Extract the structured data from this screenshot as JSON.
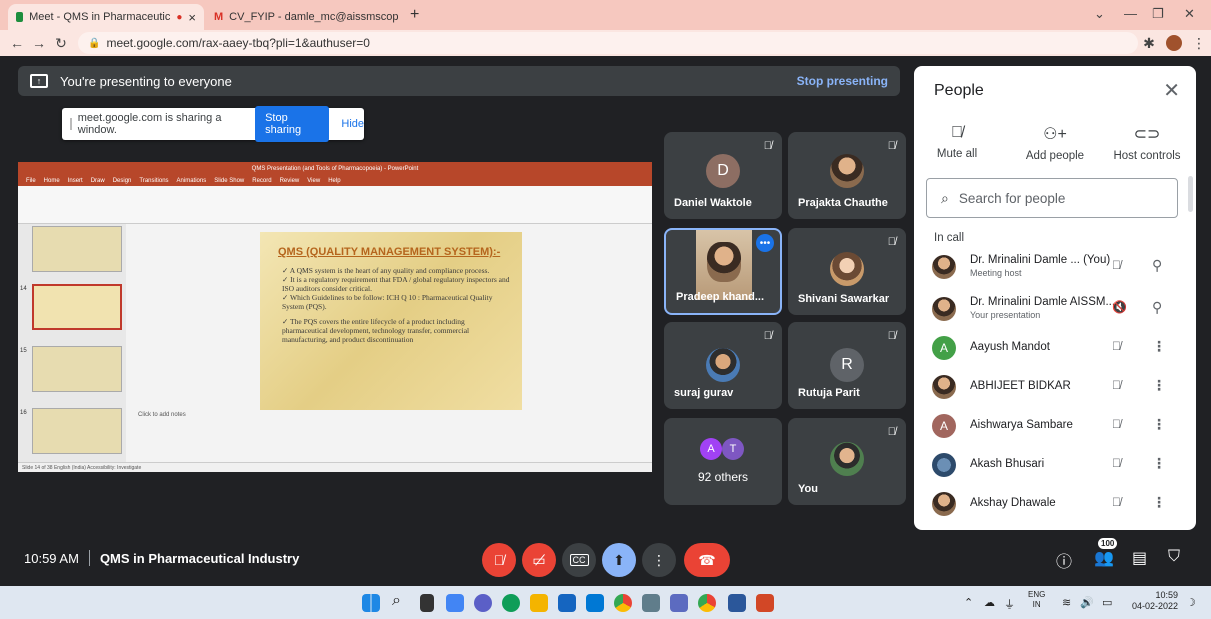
{
  "browser": {
    "tabs": [
      {
        "title": "Meet - QMS in Pharmaceutic",
        "active": true
      },
      {
        "title": "CV_FYIP - damle_mc@aissmscop",
        "active": false
      }
    ],
    "new_tab": "+",
    "url": "meet.google.com/rax-aaey-tbq?pli=1&authuser=0"
  },
  "presenting": {
    "message": "You're presenting to everyone",
    "stop_label": "Stop presenting"
  },
  "share_banner": {
    "text": "meet.google.com is sharing a window.",
    "stop_label": "Stop sharing",
    "hide_label": "Hide"
  },
  "ppt": {
    "window_title": "QMS Presentation (and Tools of Pharmacopoeia) - PowerPoint",
    "menu": [
      "File",
      "Home",
      "Insert",
      "Draw",
      "Design",
      "Transitions",
      "Animations",
      "Slide Show",
      "Record",
      "Review",
      "View",
      "Help"
    ],
    "slide_numbers": [
      "14",
      "15",
      "16"
    ],
    "slide_title": "QMS (QUALITY MANAGEMENT SYSTEM):-",
    "bullets": [
      "A QMS system is the heart of any quality and compliance process.",
      "It is a regulatory requirement that FDA / global regulatory inspectors and ISO auditors consider critical.",
      "Which Guidelines to be follow: ICH Q 10 : Pharmaceutical Quality System (PQS).",
      "The PQS covers the entire lifecycle of a product including pharmaceutical development, technology transfer, commercial manufacturing, and product discontinuation"
    ],
    "notes_placeholder": "Click to add notes",
    "status": "Slide 14 of 38   English (India)   Accessibility: Investigate"
  },
  "tiles": [
    {
      "name": "Daniel Waktole",
      "letter": "D",
      "color": "#8d6e63"
    },
    {
      "name": "Prajakta Chauthe"
    },
    {
      "name": "Pradeep khand..."
    },
    {
      "name": "Shivani Sawarkar"
    },
    {
      "name": "suraj gurav"
    },
    {
      "name": "Rutuja Parit",
      "letter": "R",
      "color": "#5f6368"
    },
    {
      "name": "92 others",
      "letters": [
        "A",
        "T"
      ]
    },
    {
      "name": "You"
    }
  ],
  "people": {
    "title": "People",
    "actions": [
      {
        "label": "Mute all",
        "icon": "mic-off-icon"
      },
      {
        "label": "Add people",
        "icon": "add-person-icon"
      },
      {
        "label": "Host controls",
        "icon": "toggle-icon"
      }
    ],
    "search_placeholder": "Search for people",
    "section": "In call",
    "list": [
      {
        "name": "Dr. Mrinalini Damle ...  (You)",
        "sub": "Meeting host"
      },
      {
        "name": "Dr. Mrinalini Damle AISSM...",
        "sub": "Your presentation"
      },
      {
        "name": "Aayush Mandot",
        "letter": "A",
        "color": "#43a047"
      },
      {
        "name": "ABHIJEET BIDKAR"
      },
      {
        "name": "Aishwarya Sambare",
        "letter": "A",
        "color": "#a1665e"
      },
      {
        "name": "Akash Bhusari"
      },
      {
        "name": "Akshay Dhawale"
      }
    ]
  },
  "meeting": {
    "time": "10:59 AM",
    "name": "QMS in Pharmaceutical Industry",
    "participant_count": "100"
  },
  "taskbar": {
    "lang_top": "ENG",
    "lang_bottom": "IN",
    "time": "10:59",
    "date": "04-02-2022"
  }
}
